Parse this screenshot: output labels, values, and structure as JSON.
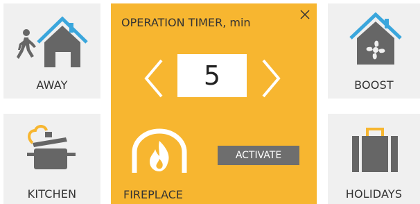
{
  "tiles": {
    "away": {
      "label": "AWAY",
      "icon": "walking-person-house-icon"
    },
    "boost": {
      "label": "BOOST",
      "icon": "fan-house-icon"
    },
    "kitchen": {
      "label": "KITCHEN",
      "icon": "cooking-pot-icon"
    },
    "holidays": {
      "label": "HOLIDAYS",
      "icon": "suitcase-icon"
    }
  },
  "panel": {
    "title": "OPERATION TIMER, min",
    "value": "5",
    "activate_label": "ACTIVATE",
    "mode_label": "FIREPLACE",
    "mode_icon": "fireplace-icon",
    "close_icon": "close-icon",
    "decrease_icon": "chevron-left-icon",
    "increase_icon": "chevron-right-icon"
  },
  "colors": {
    "accent": "#f7b630",
    "roof_blue": "#3aa6dc",
    "icon_gray": "#666666",
    "tile_bg": "#f0f0f0",
    "button_gray": "#6e6e6e"
  }
}
